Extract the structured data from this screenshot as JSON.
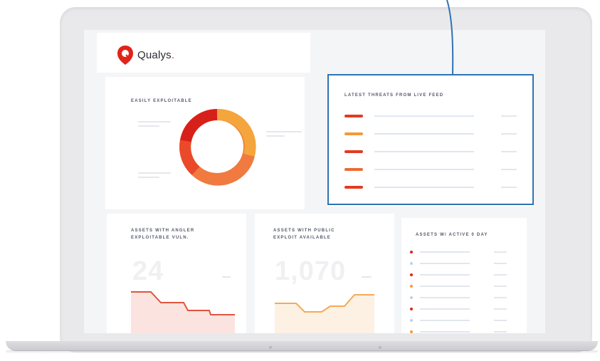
{
  "brand": {
    "name": "Qualys",
    "suffix": ".",
    "color": "#e2231a"
  },
  "panels": {
    "easily_exploitable": {
      "title": "EASILY EXPLOITABLE",
      "donut_colors": [
        "#f4a53b",
        "#f07a3f",
        "#ea4a2a",
        "#d8201a"
      ]
    },
    "latest_threats": {
      "title": "LATEST THREATS FROM LIVE FEED",
      "rows": [
        {
          "color": "#e23b20"
        },
        {
          "color": "#f29a3a"
        },
        {
          "color": "#e23b20"
        },
        {
          "color": "#ee6a34"
        },
        {
          "color": "#e23b20"
        }
      ]
    },
    "angler": {
      "title_line1": "ASSETS WITH ANGLER",
      "title_line2": "EXPLOITABLE VULN.",
      "big_value": "24",
      "line_color": "#e0553d",
      "fill_color": "#fbe4e0"
    },
    "public_exploit": {
      "title_line1": "ASSETS WITH PUBLIC",
      "title_line2": "EXPLOIT AVAILABLE",
      "big_value": "1,070",
      "line_color": "#f4a95a",
      "fill_color": "#fdf1e3"
    },
    "zero_day": {
      "title": "ASSETS W/ ACTIVE 0 DAY",
      "dot_colors": [
        "#e2231a",
        "#b9d3ea",
        "#e2231a",
        "#f29a3a",
        "#b9d3ea",
        "#e2231a",
        "#b9d3ea",
        "#f29a3a"
      ]
    }
  },
  "highlight": {
    "border_color": "#2f73b3"
  }
}
